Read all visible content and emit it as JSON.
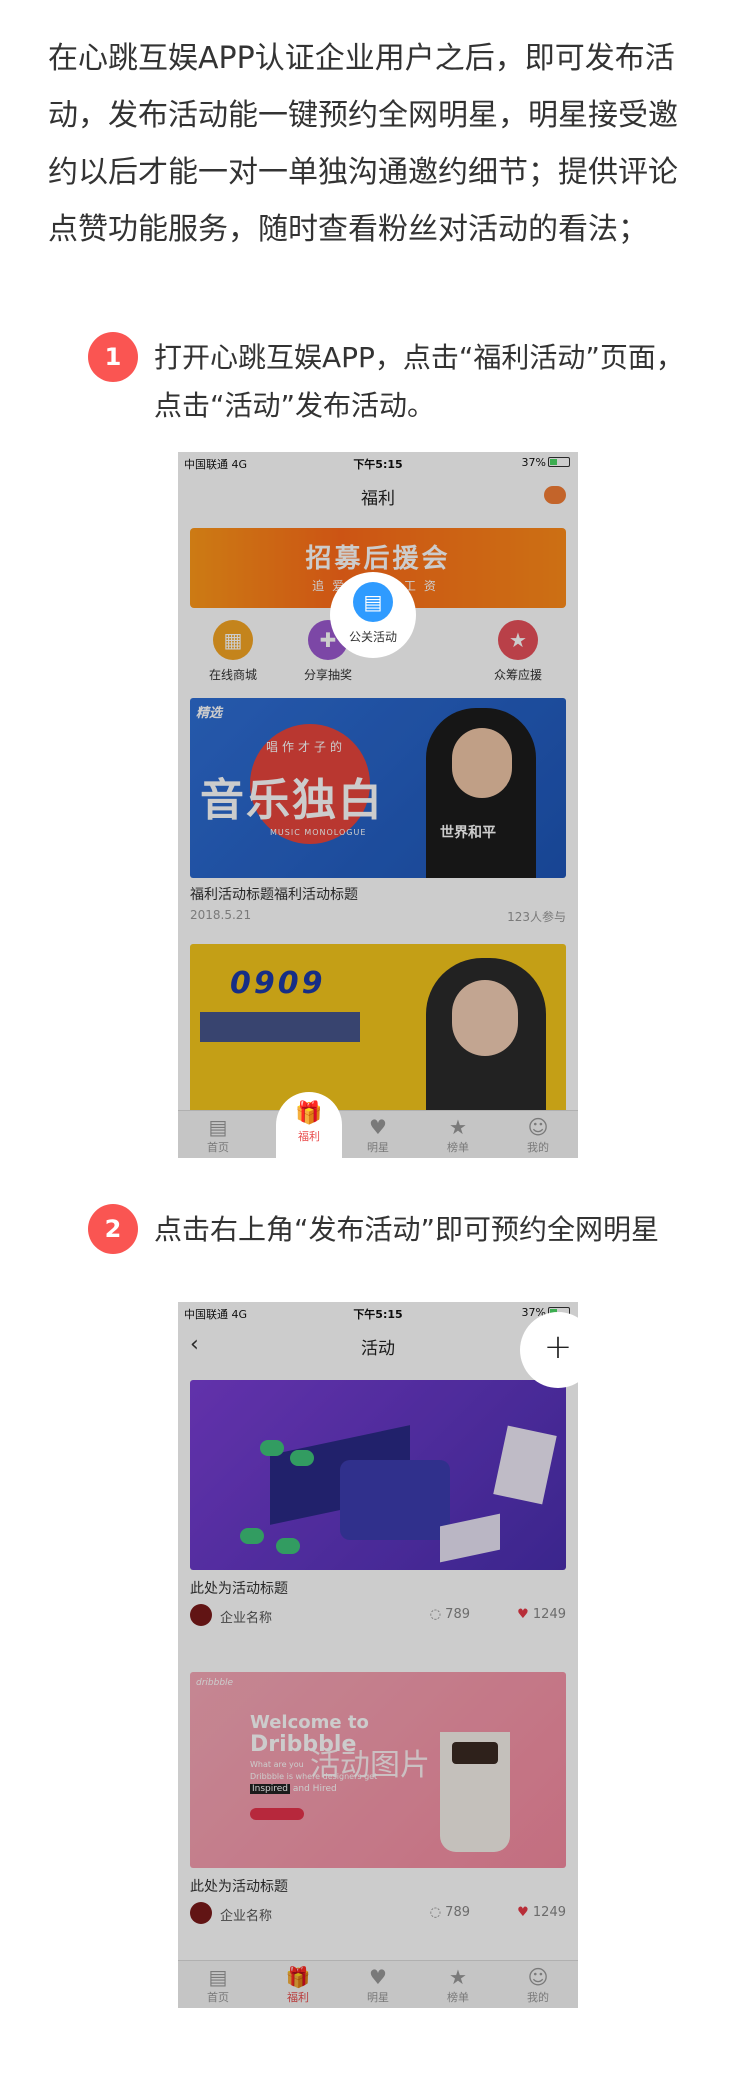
{
  "intro": "在心跳互娱APP认证企业用户之后，即可发布活动，发布活动能一键预约全网明星，明星接受邀约以后才能一对一单独沟通邀约细节；提供评论点赞功能服务，随时查看粉丝对活动的看法；",
  "steps": [
    {
      "num": "1",
      "text": "打开心跳互娱APP，点击“福利活动”页面，点击“活动”发布活动。"
    },
    {
      "num": "2",
      "text": "点击右上角“发布活动”即可预约全网明星"
    }
  ],
  "colors": {
    "accent": "#fa5552",
    "highlight": "#2f9bff",
    "like": "#e63946"
  },
  "phone1": {
    "status": {
      "carrier": "中国联通 4G",
      "time": "下午5:15",
      "right": "37%"
    },
    "title": "福利",
    "banner": {
      "title": "招募后援会",
      "sub": "追爱豆  领工资"
    },
    "categories": [
      {
        "label": "在线商城",
        "icon": "shop-icon"
      },
      {
        "label": "分享抽奖",
        "icon": "gift-icon"
      },
      {
        "label": "公关活动",
        "icon": "building-icon"
      },
      {
        "label": "众筹应援",
        "icon": "ticket-icon"
      }
    ],
    "card1": {
      "tag": "精选",
      "art_top": "唱作才子的",
      "art_main": "音乐独白",
      "art_sub": "MUSIC MONOLOGUE",
      "shirt": "世界和平",
      "title": "福利活动标题福利活动标题",
      "date": "2018.5.21",
      "count": "123人参与"
    },
    "card2": {
      "art_num": "0909"
    },
    "tabs": [
      "首页",
      "福利",
      "明星",
      "榜单",
      "我的"
    ]
  },
  "phone2": {
    "status": {
      "carrier": "中国联通 4G",
      "time": "下午5:15",
      "right": "37%"
    },
    "title": "活动",
    "back": "‹",
    "plus": "+",
    "cards": [
      {
        "title": "此处为活动标题",
        "company": "企业名称",
        "comments": "789",
        "likes": "1249"
      },
      {
        "title": "此处为活动标题",
        "company": "企业名称",
        "comments": "789",
        "likes": "1249",
        "overlay": "活动图片",
        "welcome": "Welcome to",
        "brand": "Dribbble",
        "tagline": "What are you",
        "tagline2": "Dribbble is where designers get",
        "inspired": "Inspired",
        "hired": "and Hired",
        "brand_small": "dribbble"
      }
    ],
    "tabs": [
      "首页",
      "福利",
      "明星",
      "榜单",
      "我的"
    ]
  }
}
